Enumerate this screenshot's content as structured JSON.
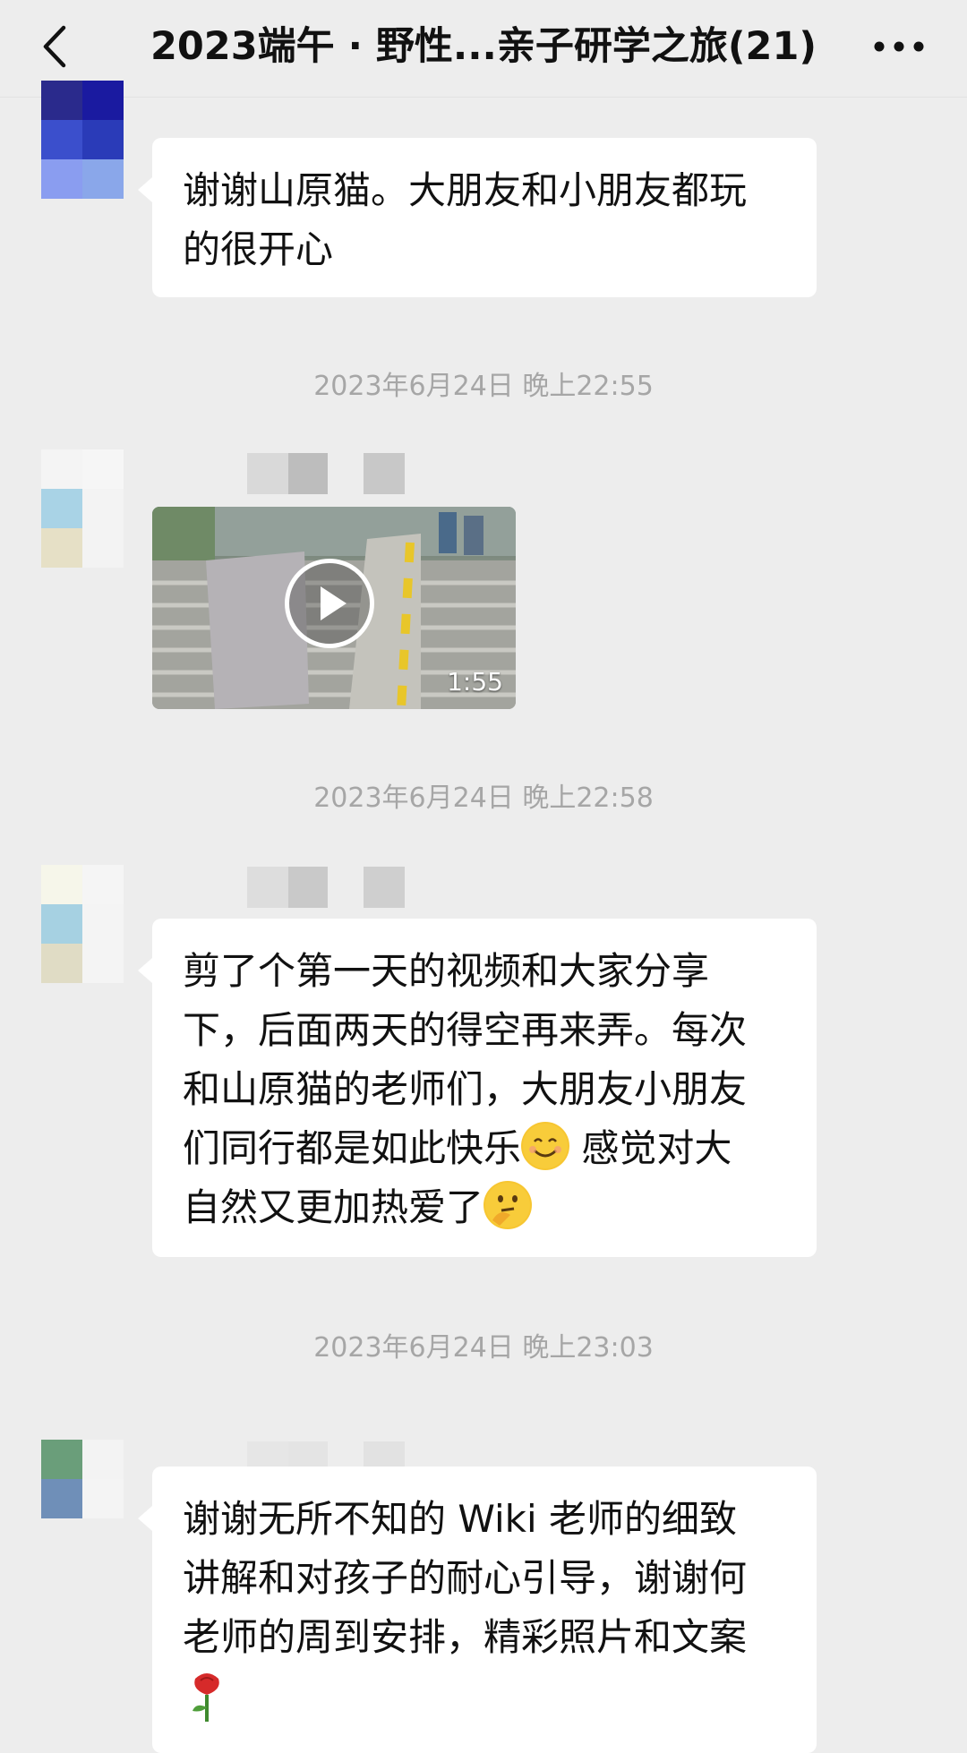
{
  "header": {
    "title": "2023端午 · 野性...亲子研学之旅(21)",
    "back_icon": "chevron-left-icon",
    "more_icon": "more-dots-icon"
  },
  "messages": [
    {
      "type": "text",
      "text_lines": [
        "谢谢山原猫。大朋友和小朋友都玩",
        "的很开心"
      ]
    },
    {
      "type": "timestamp",
      "text": "2023年6月24日 晚上22:55"
    },
    {
      "type": "video",
      "duration": "1:55",
      "play_icon": "play-icon"
    },
    {
      "type": "timestamp",
      "text": "2023年6月24日 晚上22:58"
    },
    {
      "type": "text",
      "text_lines": [
        "剪了个第一天的视频和大家分享",
        "下，后面两天的得空再来弄。每次",
        "和山原猫的老师们，大朋友小朋友",
        "们同行都是如此快乐",
        " 感觉对大",
        "自然又更加热爱了"
      ],
      "emojis": [
        "smiling-face-emoji",
        "thinking-face-emoji"
      ]
    },
    {
      "type": "timestamp",
      "text": "2023年6月24日 晚上23:03"
    },
    {
      "type": "text",
      "text_lines": [
        "谢谢无所不知的 Wiki 老师的细致",
        "讲解和对孩子的耐心引导，谢谢何",
        "老师的周到安排，精彩照片和文案"
      ],
      "emojis": [
        "rose-emoji"
      ]
    }
  ],
  "colors": {
    "background": "#ededed",
    "bubble": "#ffffff",
    "timestamp": "#a6a6a6",
    "text": "#111111"
  }
}
